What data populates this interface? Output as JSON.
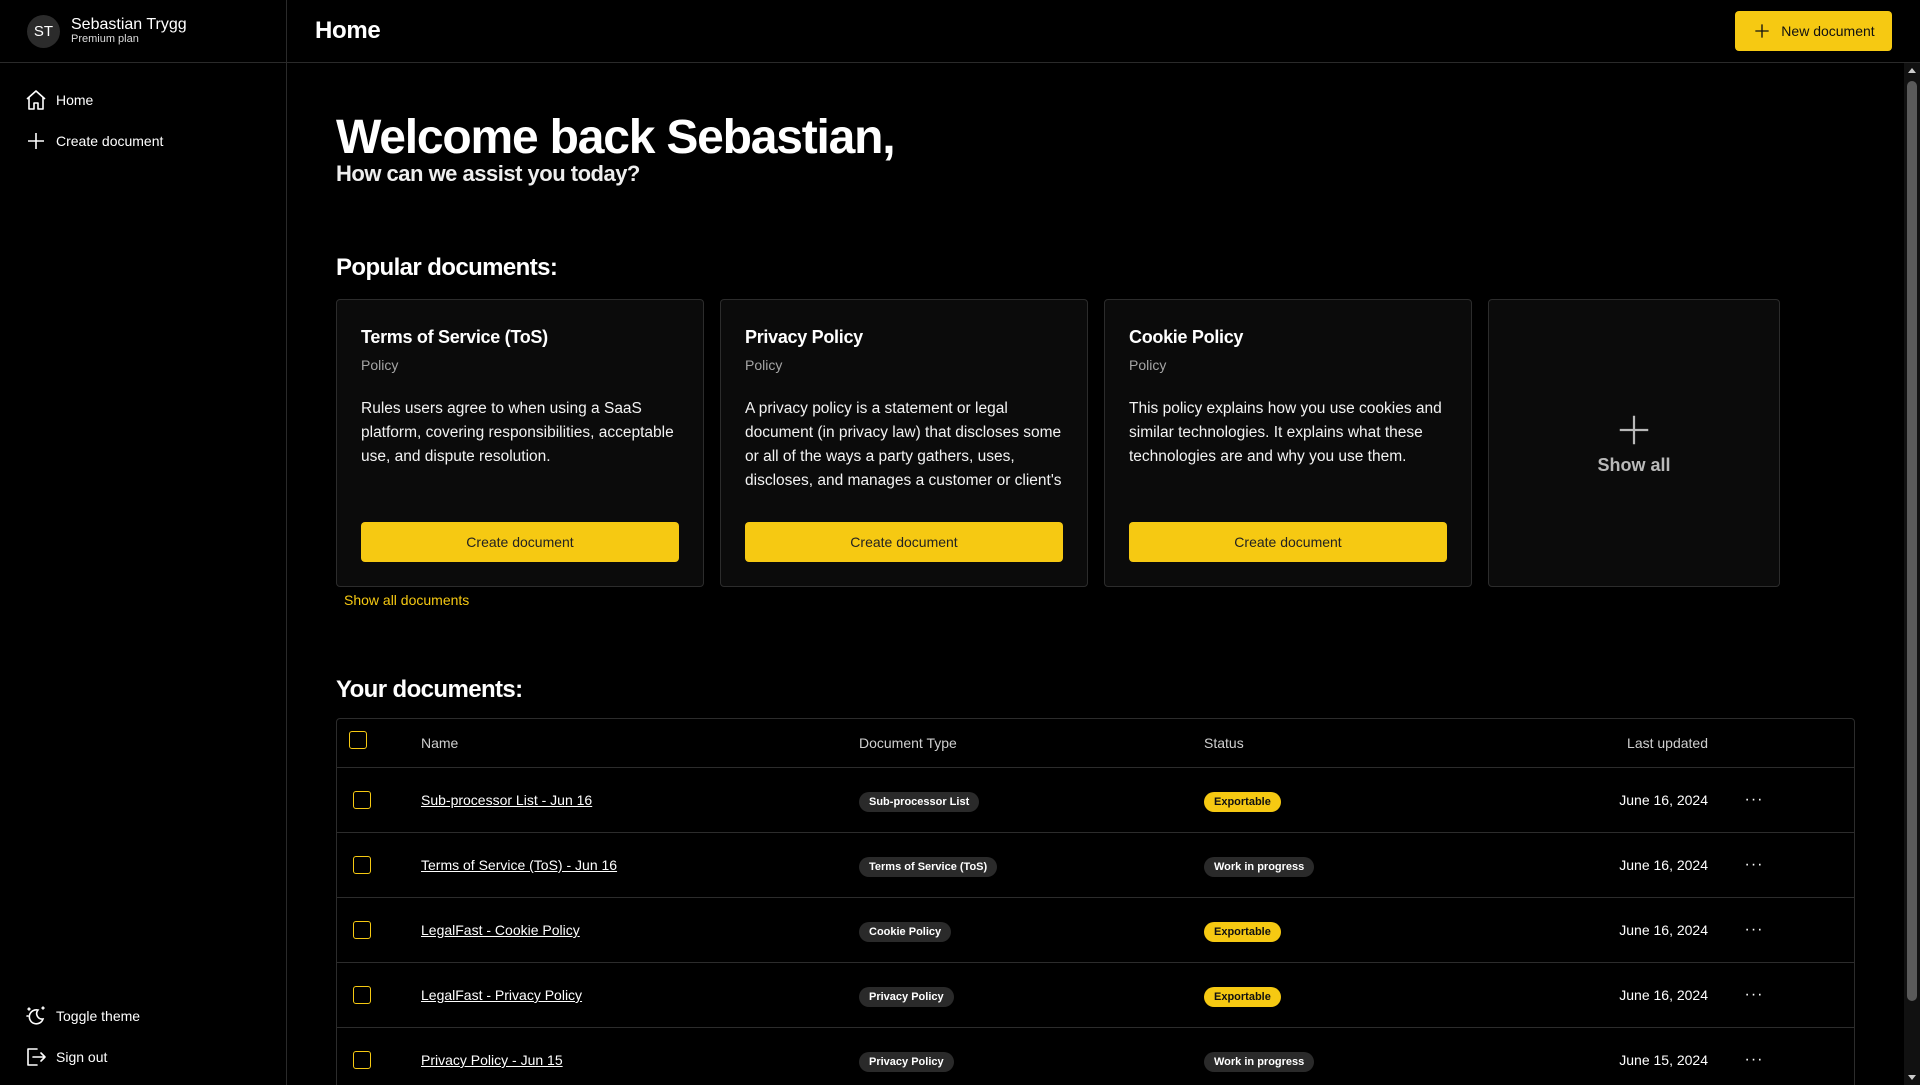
{
  "sidebar": {
    "user": {
      "initials": "ST",
      "name": "Sebastian Trygg",
      "plan": "Premium plan"
    },
    "nav": [
      {
        "label": "Home",
        "icon": "home-icon"
      },
      {
        "label": "Create document",
        "icon": "plus-icon"
      }
    ],
    "bottom": [
      {
        "label": "Toggle theme",
        "icon": "theme-icon"
      },
      {
        "label": "Sign out",
        "icon": "sign-out-icon"
      }
    ]
  },
  "header": {
    "title": "Home",
    "new_button": "New document"
  },
  "main": {
    "welcome": "Welcome back Sebastian,",
    "subtitle": "How can we assist you today?",
    "popular_title": "Popular documents:",
    "cards": [
      {
        "title": "Terms of Service (ToS)",
        "category": "Policy",
        "description": "Rules users agree to when using a SaaS platform, covering responsibilities, acceptable use, and dispute resolution.",
        "button": "Create document"
      },
      {
        "title": "Privacy Policy",
        "category": "Policy",
        "description": "A privacy policy is a statement or legal document (in privacy law) that discloses some or all of the ways a party gathers, uses, discloses, and manages a customer or client's",
        "button": "Create document"
      },
      {
        "title": "Cookie Policy",
        "category": "Policy",
        "description": "This policy explains how you use cookies and similar technologies. It explains what these technologies are and why you use them.",
        "button": "Create document"
      }
    ],
    "show_all_card": "Show all",
    "show_all_link": "Show all documents",
    "docs_title": "Your documents:",
    "table": {
      "columns": [
        "Name",
        "Document Type",
        "Status",
        "Last updated"
      ],
      "rows": [
        {
          "name": "Sub-processor List - Jun 16",
          "type": "Sub-processor List",
          "status": "Exportable",
          "date": "June 16, 2024"
        },
        {
          "name": "Terms of Service (ToS) - Jun 16",
          "type": "Terms of Service (ToS)",
          "status": "Work in progress",
          "date": "June 16, 2024"
        },
        {
          "name": "LegalFast - Cookie Policy",
          "type": "Cookie Policy",
          "status": "Exportable",
          "date": "June 16, 2024"
        },
        {
          "name": "LegalFast - Privacy Policy",
          "type": "Privacy Policy",
          "status": "Exportable",
          "date": "June 16, 2024"
        },
        {
          "name": "Privacy Policy - Jun 15",
          "type": "Privacy Policy",
          "status": "Work in progress",
          "date": "June 15, 2024"
        }
      ],
      "more_label": "···"
    }
  },
  "colors": {
    "accent": "#f6c912",
    "background": "#000000",
    "card": "#0b0b0b",
    "border": "#2c2c2c"
  }
}
